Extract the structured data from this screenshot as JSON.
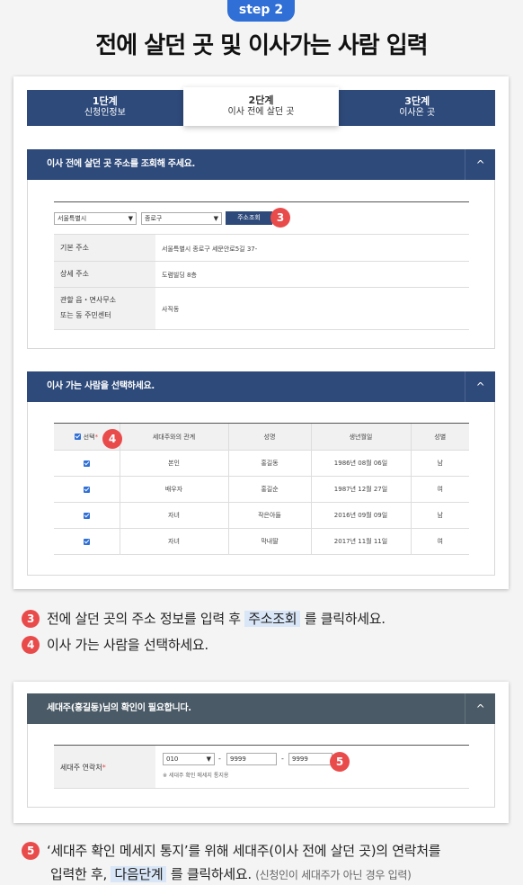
{
  "header": {
    "step_pill": "step 2",
    "title": "전에 살던 곳 및 이사가는 사람 입력"
  },
  "steps": [
    {
      "num": "1단계",
      "label": "신청인정보"
    },
    {
      "num": "2단계",
      "label": "이사 전에 살던 곳"
    },
    {
      "num": "3단계",
      "label": "이사온 곳"
    }
  ],
  "address": {
    "header": "이사 전에 살던 곳 주소를 조회해 주세요.",
    "chevron": "^",
    "city": "서울특별시",
    "district": "종로구",
    "search_button": "주소조회",
    "badge": "3",
    "rows": [
      {
        "label": "기본 주소",
        "value": "서울특별시 종로구 세문안로5길 37-"
      },
      {
        "label": "상세 주소",
        "value": "도렴빌딩 8층"
      },
      {
        "label1": "관할 읍・면사무소",
        "label2": "또는 동 주민센터",
        "value": "사직동"
      }
    ]
  },
  "movers": {
    "header": "이사 가는 사람을 선택하세요.",
    "chevron": "^",
    "badge": "4",
    "columns": [
      "선택",
      "세대주와의 관계",
      "성명",
      "생년월일",
      "성별"
    ],
    "required_mark": "*",
    "rows": [
      {
        "relation": "본인",
        "name": "홍길동",
        "birth": "1986년 08월 06일",
        "gender": "남"
      },
      {
        "relation": "배우자",
        "name": "홍길순",
        "birth": "1987년 12월 27일",
        "gender": "여"
      },
      {
        "relation": "자녀",
        "name": "작은아들",
        "birth": "2016년 09월 09일",
        "gender": "남"
      },
      {
        "relation": "자녀",
        "name": "막내딸",
        "birth": "2017년 11월 11일",
        "gender": "여"
      }
    ]
  },
  "notes": {
    "n3": {
      "badge": "3",
      "pre": "전에 살던 곳의 주소 정보를 입력 후",
      "hl": "주소조회",
      "post": "를 클릭하세요."
    },
    "n4": {
      "badge": "4",
      "text": "이사 가는 사람을 선택하세요."
    },
    "n5": {
      "badge": "5",
      "line1": "‘세대주 확인 메세지 통지’를 위해 세대주(이사 전에 살던 곳)의 연락처를",
      "pre": "입력한 후,",
      "hl": "다음단계",
      "post": "를 클릭하세요.",
      "small": "(신청인이 세대주가 아닌 경우 입력)"
    }
  },
  "householder": {
    "header": "세대주(홍길동)님의 확인이 필요합니다.",
    "chevron": "^",
    "label": "세대주 연락처",
    "required_mark": "*",
    "phone1": "010",
    "dash": "-",
    "phone2": "9999",
    "phone3": "9999",
    "hint": "※ 세대주 확인 메세지 통지용",
    "badge": "5"
  },
  "colors": {
    "navy": "#2e4a7a",
    "slate": "#4a5a66",
    "accent": "#2f6fd6",
    "badge": "#e94b4b",
    "highlight": "#d8e6f7"
  }
}
